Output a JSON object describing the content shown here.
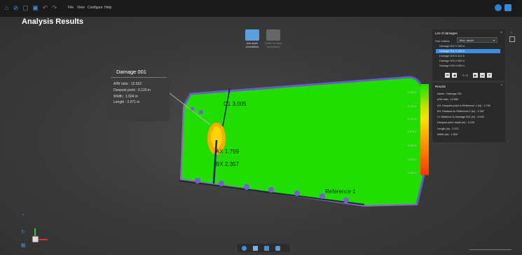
{
  "menu": [
    "File",
    "View",
    "Configure",
    "Help"
  ],
  "page_title": "Analysis Results",
  "toolbar": {
    "add_depth": "Add depth annotations",
    "delete_depth": "Delete all depth annotations"
  },
  "info_card": {
    "title": "Damage 001",
    "rows": [
      "A/W ratio : 12.562",
      "Deepest point : 0.120 in",
      "Width : 1.504 in",
      "Length : 2.971 in"
    ]
  },
  "list_panel": {
    "title": "List of damages",
    "sort_label": "Sort criteria",
    "sort_value": "Max. depth",
    "items": [
      "Damage 002  0.150 in",
      "Damage 001  0.120 in",
      "Damage 003  0.110 in",
      "Damage 004  0.060 in",
      "Damage 005  0.050 in"
    ],
    "selected_index": 1,
    "page_text": "2 / 5"
  },
  "results_panel": {
    "title": "Results",
    "rows": [
      "Name : Damage 001",
      "A/W ratio : 12.562",
      "AX: Deepest point to Reference 1 (in) : 1.799",
      "BX: Distance to Reference 1 (in) : 2.357",
      "Cl: Distance to Damage 002 (in) : 3.005",
      "Deepest point depth (in) : 0.120",
      "Length (in) : 2.971",
      "Width (in) : 1.504"
    ]
  },
  "scale": [
    "0.150 in",
    "0.125 in",
    "0.100 in",
    "0.075 in",
    "0.050 in",
    "0.025 in",
    "0.000 in"
  ],
  "annotations": {
    "c1": "C1 3.005",
    "ax": "AX 1.799",
    "bx": "BX 2.357",
    "ref": "Reference 1"
  },
  "colors": {
    "accent": "#3b8fe6",
    "surface": "#22dd00"
  }
}
